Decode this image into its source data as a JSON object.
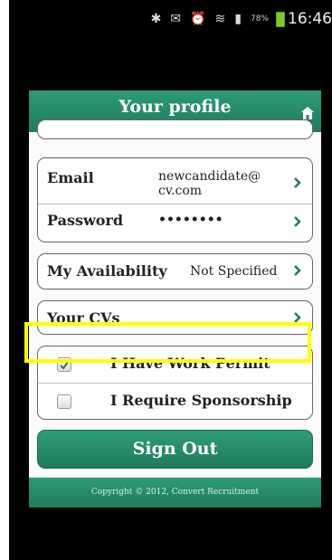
{
  "status_bar": {
    "battery": "78%",
    "time": "16:46",
    "icons": [
      "bluetooth-icon",
      "vibrate-icon",
      "alarm-icon",
      "wifi-icon",
      "signal-icon",
      "battery-icon"
    ]
  },
  "header": {
    "title": "Your profile",
    "home_icon": "home-icon"
  },
  "profile": {
    "email_label": "Email",
    "email_value": "newcandidate@\ncv.com",
    "password_label": "Password",
    "password_value": "••••••••",
    "availability_label": "My Availability",
    "availability_value": "Not Specified",
    "cvs_label": "Your CVs"
  },
  "permissions": {
    "work_permit_label": "I Have Work Permit",
    "work_permit_checked": true,
    "sponsorship_label": "I Require Sponsorship",
    "sponsorship_checked": false
  },
  "actions": {
    "sign_out_label": "Sign Out"
  },
  "footer": {
    "copyright": "Copyright © 2012, Convert Recruitment"
  },
  "colors": {
    "brand_green": "#237f5f",
    "highlight": "#ffff00"
  }
}
